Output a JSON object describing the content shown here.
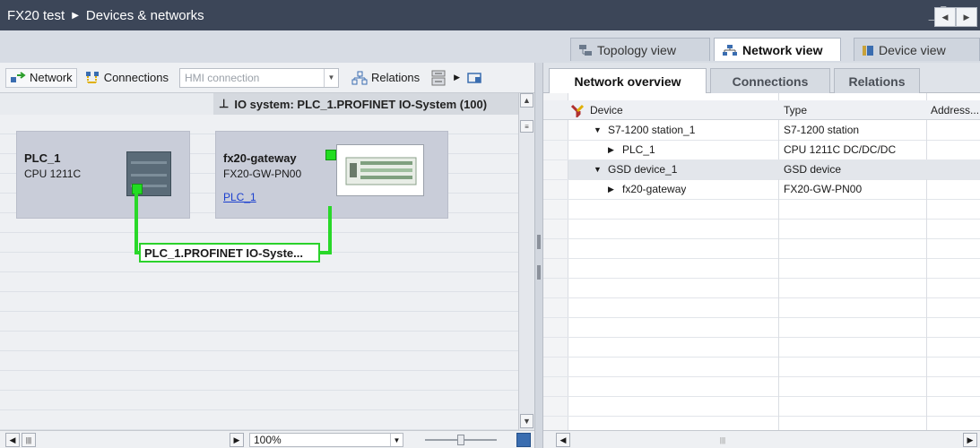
{
  "title": {
    "project": "FX20 test",
    "separator": "▶",
    "section": "Devices & networks",
    "controls": [
      "_",
      "▘",
      "■",
      "×"
    ]
  },
  "view_tabs": {
    "topology": "Topology view",
    "network": "Network view",
    "device": "Device view"
  },
  "toolbar": {
    "network": "Network",
    "connections": "Connections",
    "hmi_connection_placeholder": "HMI connection",
    "relations": "Relations"
  },
  "canvas": {
    "io_system": "IO system: PLC_1.PROFINET IO-System (100)",
    "devices": [
      {
        "name": "PLC_1",
        "type": "CPU 1211C"
      },
      {
        "name": "fx20-gateway",
        "type": "FX20-GW-PN00",
        "link": "PLC_1"
      }
    ],
    "network_label": "PLC_1.PROFINET IO-Syste..."
  },
  "zoom": {
    "value": "100%"
  },
  "overview": {
    "tabs": [
      "Network overview",
      "Connections",
      "Relations"
    ],
    "columns": [
      "Device",
      "Type",
      "Address..."
    ],
    "rows": [
      {
        "indent": 1,
        "expander": "▼",
        "device": "S7-1200 station_1",
        "type": "S7-1200 station"
      },
      {
        "indent": 2,
        "expander": "▶",
        "device": "PLC_1",
        "type": "CPU 1211C DC/DC/DC"
      },
      {
        "indent": 1,
        "expander": "▼",
        "device": "GSD device_1",
        "type": "GSD device"
      },
      {
        "indent": 2,
        "expander": "▶",
        "device": "fx20-gateway",
        "type": "FX20-GW-PN00"
      }
    ]
  },
  "colors": {
    "titlebar": "#3c4658",
    "port_green": "#22dd22",
    "link_blue": "#1a3fcf"
  }
}
